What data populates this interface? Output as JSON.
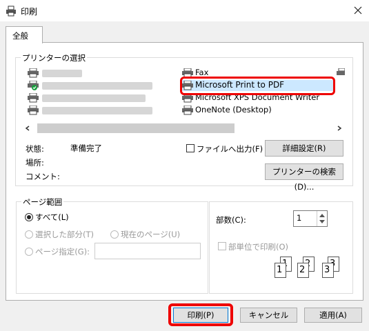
{
  "window": {
    "title": "印刷"
  },
  "tabs": [
    {
      "label": "全般"
    }
  ],
  "printer_group": {
    "label": "プリンターの選択",
    "printers": [
      {
        "name": "",
        "blurred": true
      },
      {
        "name": "",
        "blurred": true
      },
      {
        "name": "",
        "blurred": true
      },
      {
        "name": "",
        "blurred": true
      },
      {
        "name": "Fax"
      },
      {
        "name": "Microsoft Print to PDF",
        "selected": true
      },
      {
        "name": "Microsoft XPS Document Writer"
      },
      {
        "name": "OneNote (Desktop)"
      }
    ]
  },
  "status": {
    "status_label": "状態:",
    "status_value": "準備完了",
    "location_label": "場所:",
    "comment_label": "コメント:",
    "print_to_file": "ファイルへ出力(F)",
    "details_button": "詳細設定(R)",
    "find_printer_button": "プリンターの検索(D)..."
  },
  "page_range": {
    "label": "ページ範囲",
    "all": "すべて(L)",
    "selection": "選択した部分(T)",
    "current_page": "現在のページ(U)",
    "pages": "ページ指定(G):"
  },
  "copies": {
    "label": "部数(C):",
    "value": "1",
    "collate": "部単位で印刷(O)",
    "collate_numbers": [
      "1",
      "1",
      "2",
      "2",
      "3",
      "3"
    ]
  },
  "buttons": {
    "print": "印刷(P)",
    "cancel": "キャンセル",
    "apply": "適用(A)"
  },
  "colors": {
    "highlight": "#e00000",
    "selection": "#cce8ff"
  }
}
